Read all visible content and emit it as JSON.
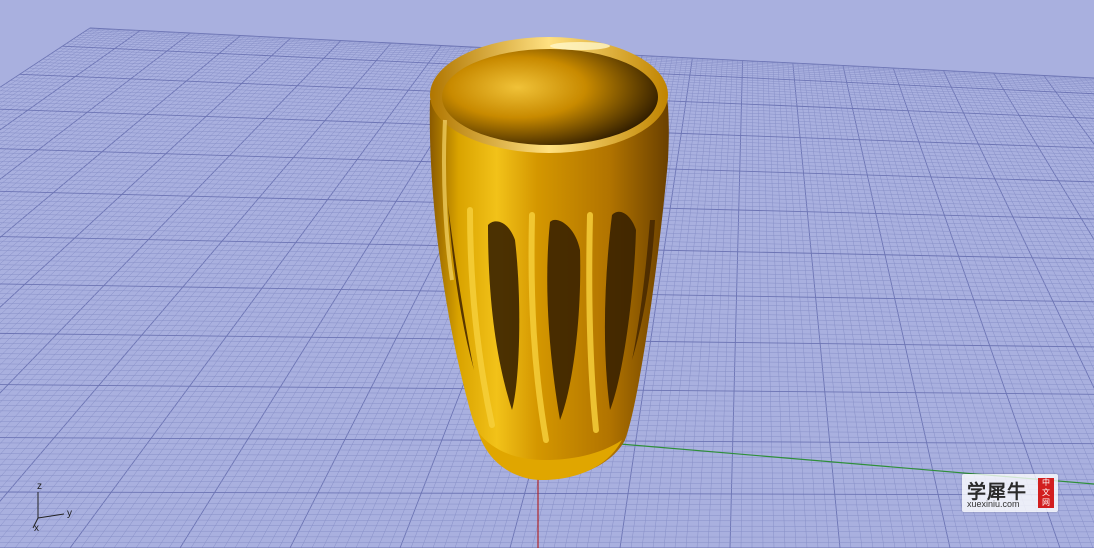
{
  "viewport": {
    "background_color": "#a9b0df",
    "grid_minor_color": "#8890c8",
    "grid_major_color": "#6c74b4",
    "x_axis_color": "#b0262a",
    "y_axis_color": "#2f8f3a",
    "object_color": "#d99a00",
    "object_highlight": "#fff0a0",
    "object_shadow": "#2a1a00"
  },
  "axis_widget": {
    "z_label": "z",
    "y_label": "y",
    "x_label": "x"
  },
  "watermark": {
    "main": "学犀牛",
    "sub": "xuexiniu.com",
    "badge": [
      "中",
      "文",
      "网"
    ]
  }
}
